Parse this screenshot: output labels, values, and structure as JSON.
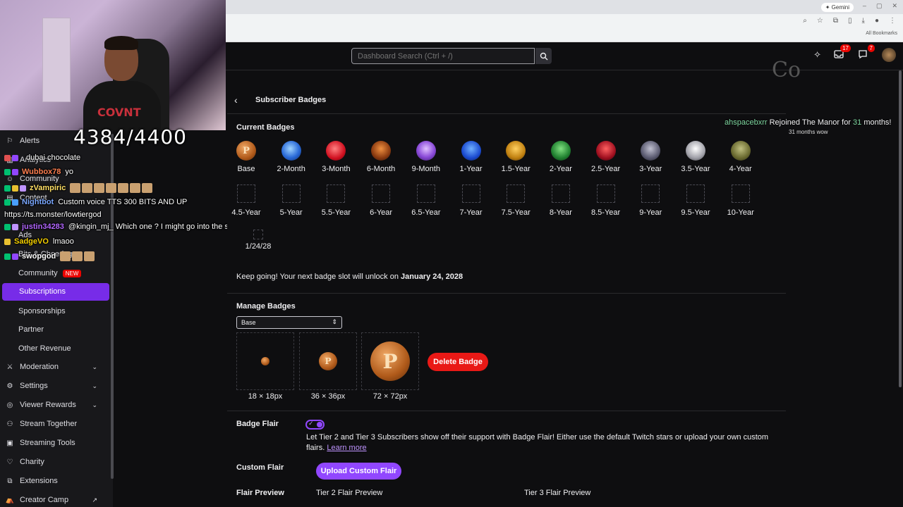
{
  "browser": {
    "gemini_label": "Gemini",
    "bookmarks_label": "All Bookmarks",
    "window_controls": [
      "–",
      "▢",
      "✕"
    ]
  },
  "overlay": {
    "sub_counter": "4384/4400",
    "cam_shirt_text": "COVNT",
    "alert_user": "ahspacebxrr",
    "alert_text_a": "Rejoined The Manor for",
    "alert_months": "31",
    "alert_text_b": "months!",
    "alert_sub": "31 months wow",
    "corner_text": "Co"
  },
  "topnav": {
    "search_placeholder": "Dashboard Search (Ctrl + /)",
    "notifications_count": "17",
    "whispers_count": "7"
  },
  "sidebar": {
    "alerts_label": "Alerts",
    "analytics_label": "Analytics",
    "community_label": "Community",
    "content_label": "Content",
    "ads_label": "Ads",
    "bits_label": "Bits & Cheering",
    "community2_label": "Community",
    "new_badge": "NEW",
    "subscriptions_label": "Subscriptions",
    "sponsorships_label": "Sponsorships",
    "partner_label": "Partner",
    "other_revenue_label": "Other Revenue",
    "moderation_label": "Moderation",
    "settings_label": "Settings",
    "viewer_rewards_label": "Viewer Rewards",
    "stream_together_label": "Stream Together",
    "streaming_tools_label": "Streaming Tools",
    "charity_label": "Charity",
    "extensions_label": "Extensions",
    "creator_camp_label": "Creator Camp"
  },
  "chat": [
    {
      "user": "",
      "text": "dubai chocolate",
      "color": "#ff4d6d"
    },
    {
      "user": "Wubbox78",
      "text": "yo",
      "color": "#ff7f50"
    },
    {
      "user": "zVampiric",
      "text": "",
      "color": "#ffe066"
    },
    {
      "user": "Nightbot",
      "text": "Custom voice TTS 300 BITS AND UP",
      "color": "#7aa7ff"
    },
    {
      "user": "",
      "text": "https://ts.monster/lowtiergod",
      "color": "#ffffff"
    },
    {
      "user": "justin34283",
      "text": "@kingin_mj_ Which one ? I might go into the space force",
      "color": "#b266ff"
    },
    {
      "user": "SadgeVO",
      "text": "lmaoo",
      "color": "#f5d000"
    },
    {
      "user": "swopgod",
      "text": "",
      "color": "#ffffff"
    }
  ],
  "main": {
    "panel_title": "Subscriber Badges",
    "current_badges_label": "Current Badges",
    "badges_row1": [
      "Base",
      "2-Month",
      "3-Month",
      "6-Month",
      "9-Month",
      "1-Year",
      "1.5-Year",
      "2-Year",
      "2.5-Year",
      "3-Year",
      "3.5-Year",
      "4-Year"
    ],
    "badges_row2": [
      "4.5-Year",
      "5-Year",
      "5.5-Year",
      "6-Year",
      "6.5-Year",
      "7-Year",
      "7.5-Year",
      "8-Year",
      "8.5-Year",
      "9-Year",
      "9.5-Year",
      "10-Year"
    ],
    "locked_slot_label": "1/24/28",
    "hint_prefix": "Keep going! Your next badge slot will unlock on",
    "hint_date": "January 24, 2028",
    "manage_label": "Manage Badges",
    "select_value": "Base",
    "sizes": [
      "18 × 18px",
      "36 × 36px",
      "72 × 72px"
    ],
    "coin_letter": "P",
    "delete_label": "Delete Badge",
    "flair_label": "Badge Flair",
    "flair_desc": "Let Tier 2 and Tier 3 Subscribers show off their support with Badge Flair! Either use the default Twitch stars or upload your own custom flairs.",
    "learn_more": "Learn more",
    "custom_flair_label": "Custom Flair",
    "upload_label": "Upload Custom Flair",
    "flair_preview_label": "Flair Preview",
    "tier2_preview": "Tier 2 Flair Preview",
    "tier3_preview": "Tier 3 Flair Preview"
  },
  "colors": {
    "accent": "#9147ff",
    "active_bg": "#772ce8",
    "danger": "#e91916",
    "link": "#bf94ff"
  }
}
